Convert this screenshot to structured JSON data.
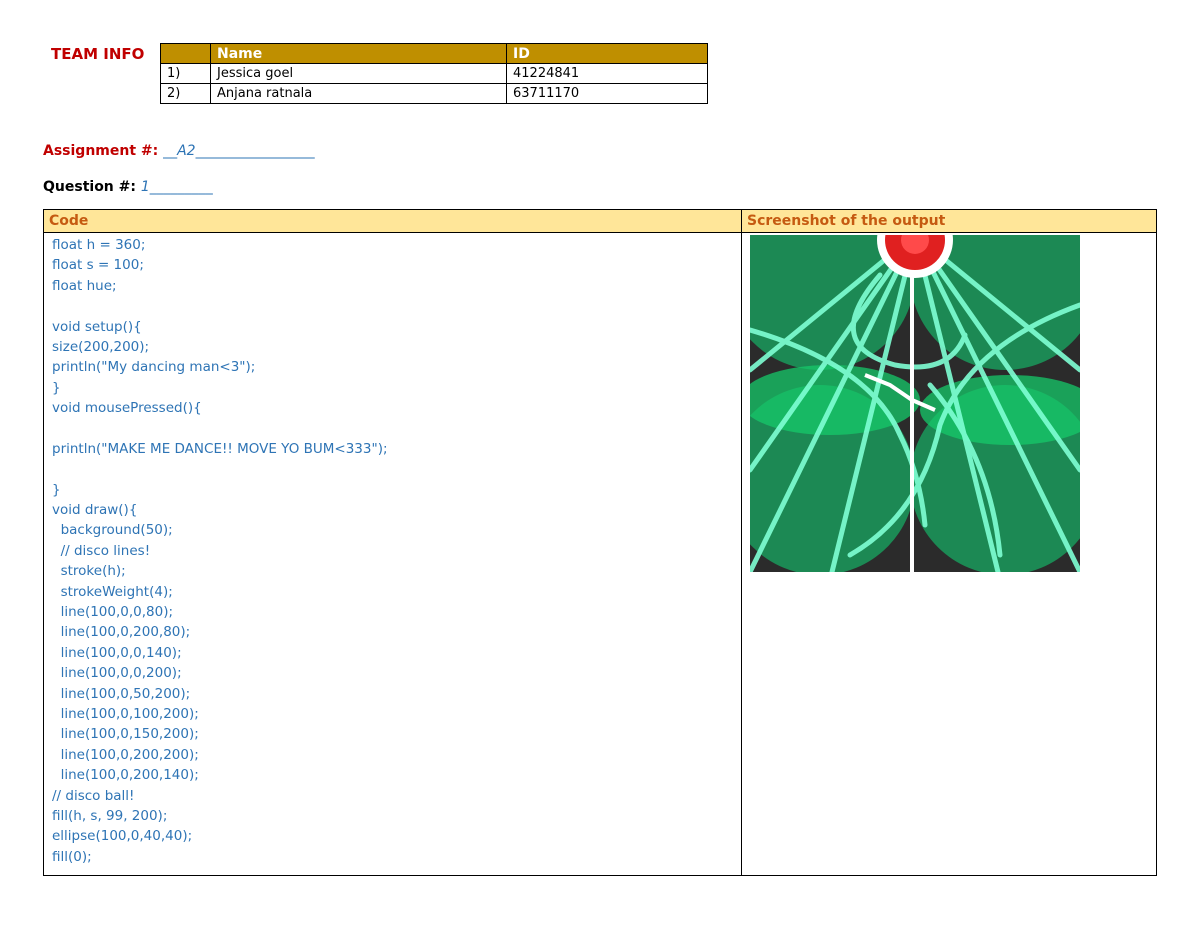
{
  "team": {
    "label": "TEAM INFO",
    "headers": [
      "",
      "Name",
      "ID"
    ],
    "rows": [
      [
        "1)",
        "Jessica goel",
        "41224841"
      ],
      [
        "2)",
        "Anjana ratnala",
        "63711170"
      ]
    ]
  },
  "assignment": {
    "label": "Assignment #:",
    "value": "__A2_________________"
  },
  "question": {
    "label": "Question #:",
    "value": "1_________"
  },
  "code_table": {
    "code_header": "Code",
    "output_header": "Screenshot of the output",
    "code_lines": [
      "float h = 360;",
      "float s = 100;",
      "float hue;",
      "",
      "void setup(){",
      "size(200,200);",
      "println(\"My dancing man<3\");",
      "}",
      "void mousePressed(){",
      "",
      "println(\"MAKE ME DANCE!! MOVE YO BUM<333\");",
      "",
      "}",
      "void draw(){",
      "  background(50);",
      "  // disco lines!",
      "  stroke(h);",
      "  strokeWeight(4);",
      "  line(100,0,0,80);",
      "  line(100,0,200,80);",
      "  line(100,0,0,140);",
      "  line(100,0,0,200);",
      "  line(100,0,50,200);",
      "  line(100,0,100,200);",
      "  line(100,0,150,200);",
      "  line(100,0,200,200);",
      "  line(100,0,200,140);",
      "// disco ball!",
      "fill(h, s, 99, 200);",
      "ellipse(100,0,40,40);",
      "fill(0);"
    ]
  },
  "colors": {
    "accent_red": "#c00000",
    "header_gold": "#bf8f00",
    "code_header_bg": "#ffe699",
    "code_text": "#2e74b5",
    "output_bg": "#2b2b2b",
    "output_green": "#1a9a5c",
    "output_line": "#7fffd4",
    "disco_ball": "#e02020"
  }
}
